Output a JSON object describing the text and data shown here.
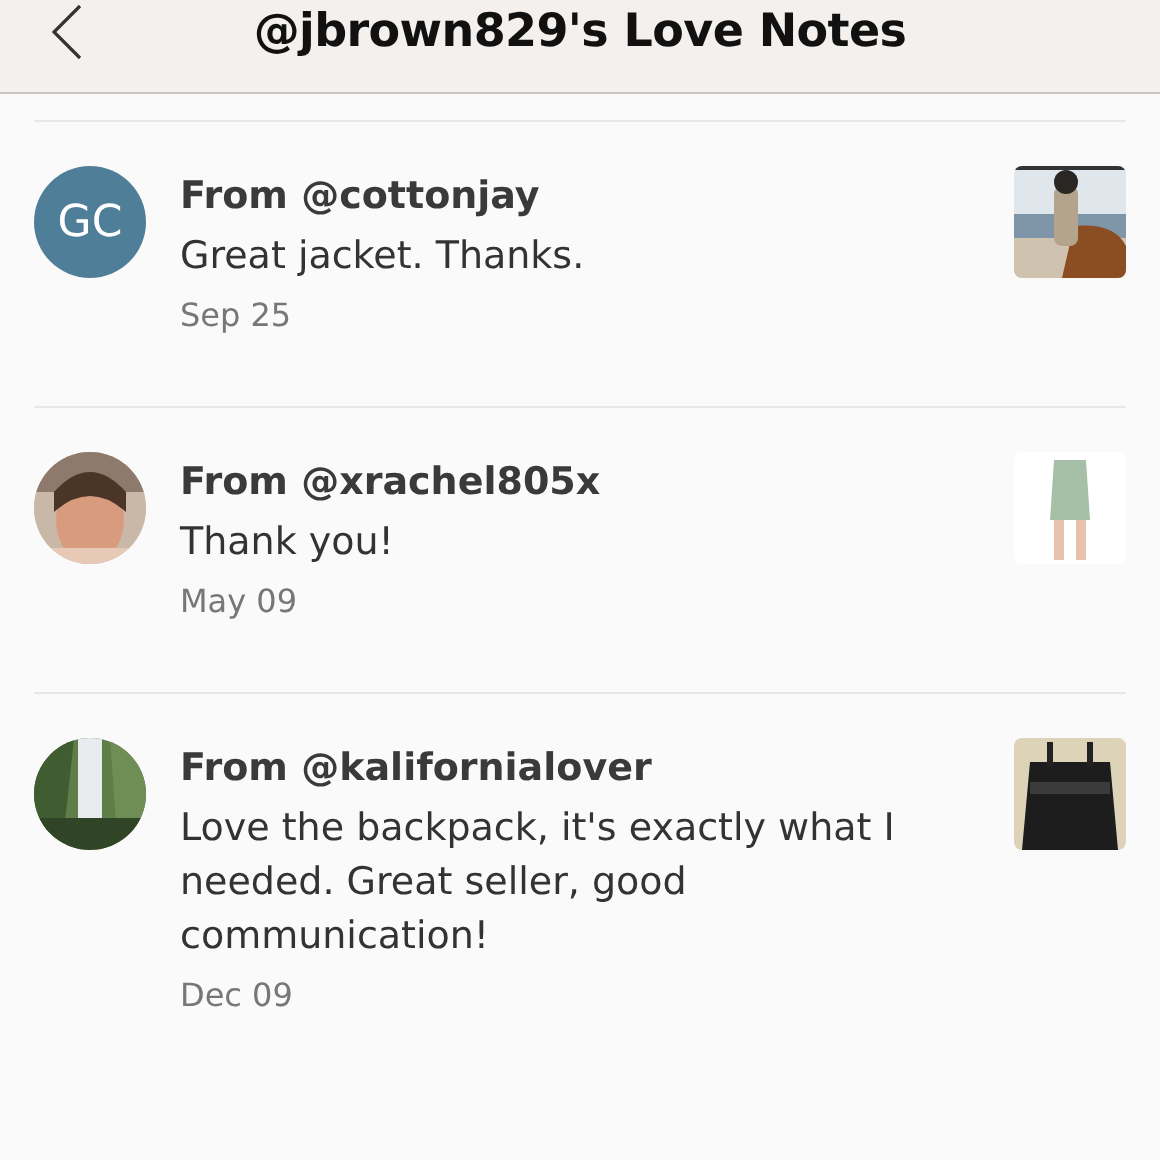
{
  "header": {
    "title": "@jbrown829's Love Notes"
  },
  "notes": [
    {
      "avatar": {
        "kind": "initials",
        "text": "GC"
      },
      "from": "From @cottonjay",
      "message": "Great jacket. Thanks.",
      "date": "Sep 25"
    },
    {
      "from": "From @xrachel805x",
      "message": "Thank you!",
      "date": "May 09"
    },
    {
      "from": "From @kalifornialover",
      "message": "Love the backpack, it's exactly what I needed. Great seller, good communication!",
      "date": "Dec 09"
    }
  ]
}
